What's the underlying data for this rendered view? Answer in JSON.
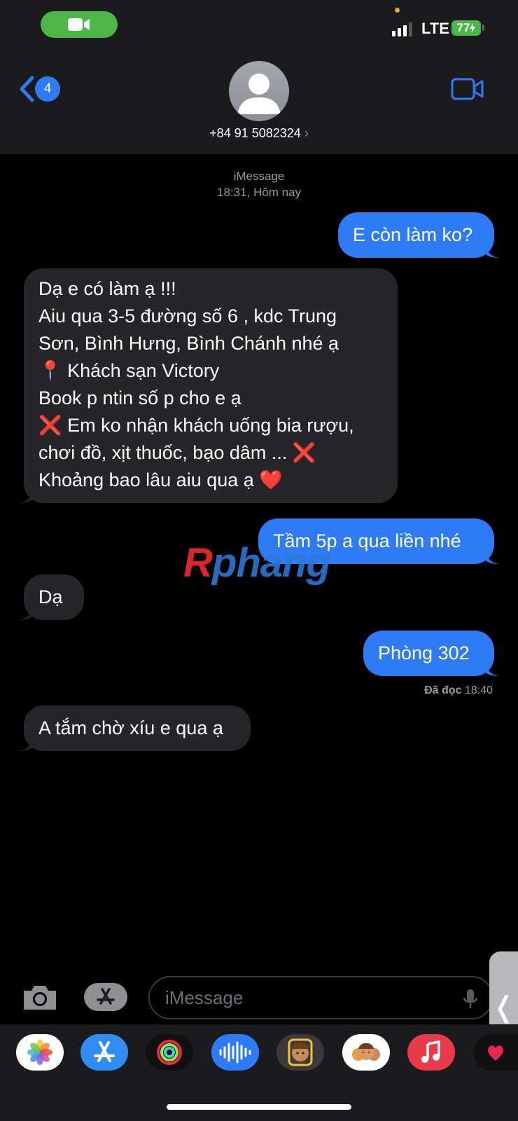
{
  "status_bar": {
    "network": "LTE",
    "battery": "77"
  },
  "header": {
    "back_count": "4",
    "contact": "+84 91 5082324",
    "contact_chevron": "›"
  },
  "thread": {
    "service": "iMessage",
    "timestamp": "18:31, Hôm nay",
    "messages": [
      {
        "direction": "outgoing",
        "lines": [
          "E còn làm ko?"
        ]
      },
      {
        "direction": "incoming",
        "lines": [
          "Dạ e có làm ạ !!!",
          "Aiu qua 3-5 đường số 6 , kdc Trung",
          "Sơn, Bình Hưng, Bình Chánh nhé ạ",
          "📍 Khách sạn Victory",
          "Book p ntin số p cho e ạ",
          "❌ Em ko nhận khách uống bia rượu,",
          "chơi đồ, xịt thuốc, bạo dâm ... ❌",
          "Khoảng bao lâu aiu qua ạ ❤️"
        ]
      },
      {
        "direction": "outgoing",
        "lines": [
          "Tầm 5p a qua liền nhé"
        ]
      },
      {
        "direction": "incoming",
        "lines": [
          "Dạ"
        ]
      },
      {
        "direction": "outgoing",
        "lines": [
          "Phòng 302"
        ]
      },
      {
        "direction": "incoming",
        "lines": [
          "A tắm chờ xíu e qua ạ"
        ]
      }
    ],
    "read_label": "Đã đọc",
    "read_time": "18:40"
  },
  "watermark": {
    "part1": "R",
    "part2": "phang"
  },
  "composer": {
    "placeholder": "iMessage",
    "side_tab_glyph": "❬"
  },
  "app_drawer": [
    "photos-app",
    "app-store-app",
    "activity-app",
    "audio-message-app",
    "memoji-app",
    "memoji-stickers-app",
    "music-app",
    "heart-app"
  ],
  "colors": {
    "outgoing_bubble": "#2f7bf6",
    "incoming_bubble": "#26252a",
    "facetime_green": "#4cb648"
  }
}
